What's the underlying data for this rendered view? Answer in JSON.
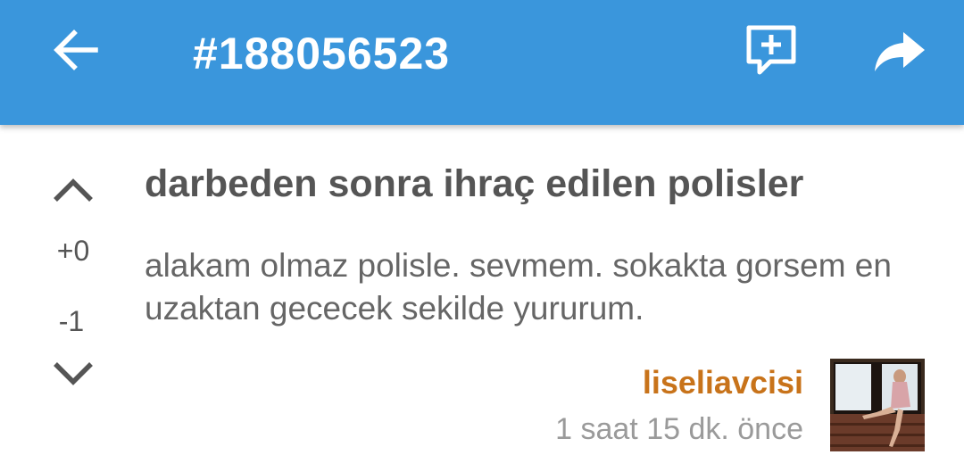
{
  "header": {
    "title": "#188056523",
    "icons": {
      "back": "arrow-back-icon",
      "add_comment": "add-comment-icon",
      "share": "share-icon"
    },
    "bar_color": "#3a96dc"
  },
  "votes": {
    "up_icon": "chevron-up-icon",
    "down_icon": "chevron-down-icon",
    "plus": "+0",
    "minus": "-1"
  },
  "entry": {
    "title": "darbeden sonra ihraç edilen polisler",
    "body": "alakam olmaz polisle. sevmem. sokakta gorsem en uzaktan gececek sekilde yururum.",
    "author": "liseliavcisi",
    "author_color": "#c8731a",
    "timestamp": "1 saat 15 dk. önce"
  }
}
